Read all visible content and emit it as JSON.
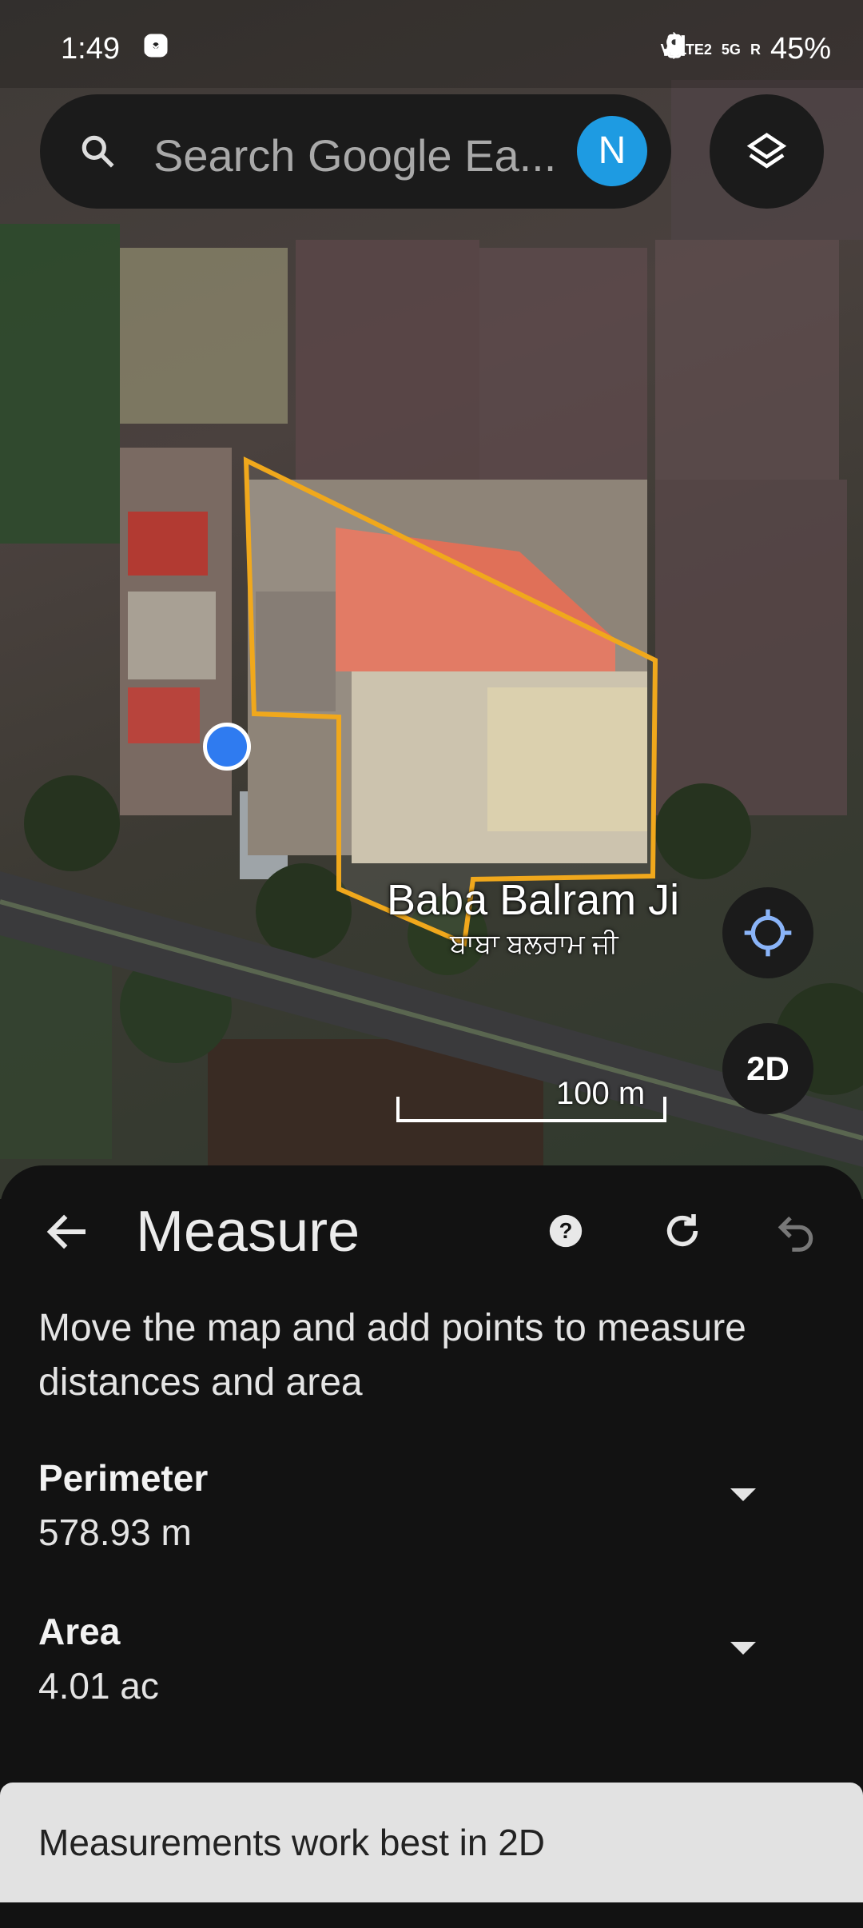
{
  "status_bar": {
    "time": "1:49",
    "network_label": "5G",
    "volte_label": "VoLTE2",
    "roaming_label": "R",
    "battery": "45%",
    "notification_icons": [
      "chat-icon",
      "chrome-icon",
      "gmail-icon",
      "instagram-icon"
    ],
    "system_icons": [
      "bluetooth-icon",
      "location-icon",
      "signal-icon",
      "battery-icon"
    ]
  },
  "search": {
    "placeholder": "Search Google Ea...",
    "avatar_initial": "N",
    "avatar_color": "#1e9be2"
  },
  "map": {
    "place_name": "Baba Balram Ji",
    "place_name_local": "ਬਾਬਾ ਬਲਰਾਮ ਜੀ",
    "scale_label": "100 m",
    "view_mode_button": "2D",
    "outline_color": "#f0a81c",
    "location_dot_color": "#2f7bf0"
  },
  "panel": {
    "title": "Measure",
    "instructions": "Move the map and add points to measure distances and area",
    "metrics": [
      {
        "label": "Perimeter",
        "value": "578.93 m"
      },
      {
        "label": "Area",
        "value": "4.01 ac"
      }
    ],
    "hint": "Measurements work best in 2D"
  }
}
